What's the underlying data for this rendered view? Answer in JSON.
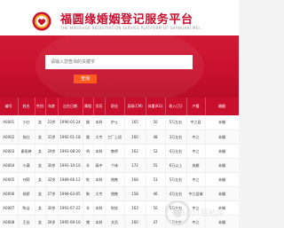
{
  "header": {
    "title": "福圆缘婚姻登记服务平台",
    "subtitle": "THE MARRIAGE REGISTRATION SERVICE PLATFORM OF SHANGHAI MEI..."
  },
  "search": {
    "placeholder": "请输入您查询的关键字",
    "button_label": "查询"
  },
  "table": {
    "columns": [
      "编号",
      "姓名",
      "性别",
      "年龄",
      "出生日期",
      "属相",
      "学历",
      "职业",
      "身高(CM)",
      "体重(KG)",
      "收入(万)",
      "户籍",
      "婚姻"
    ],
    "rows": [
      [
        "A0001",
        "小红",
        "女",
        "23岁",
        "1990-05-24",
        "猴",
        "本科",
        "护士",
        "165",
        "50",
        "5万左右",
        "中江县",
        "未婚"
      ],
      [
        "A0002",
        "张红",
        "女",
        "31岁",
        "1992-01-18",
        "猴",
        "大专",
        "工厂上班",
        "160",
        "48",
        "3万左右",
        "中江",
        "未婚"
      ],
      [
        "A0003",
        "谢雨婷",
        "女",
        "29岁",
        "1993-08-20",
        "鸡",
        "本科",
        "教师",
        "162",
        "52",
        "4万左右",
        "中江",
        "未婚"
      ],
      [
        "A0004",
        "小满",
        "女",
        "30岁",
        "1991-10-10",
        "羊",
        "高中",
        "个体",
        "172",
        "55",
        "6万以上",
        "成都",
        "未婚"
      ],
      [
        "A0005",
        "刘莉",
        "女",
        "32岁",
        "1989-06-12",
        "蛇",
        "本科",
        "销售",
        "168",
        "53",
        "5万左右",
        "中江",
        "未婚"
      ],
      [
        "A0006",
        "胡娇",
        "女",
        "27岁",
        "1994-03-05",
        "狗",
        "大专",
        "销售",
        "158",
        "46",
        "4万左右",
        "中江县城",
        "未婚"
      ],
      [
        "A0007",
        "陈洁",
        "女",
        "30岁",
        "1991-07-22",
        "羊",
        "本科",
        "财务",
        "163",
        "50",
        "5万左右",
        "中江",
        "未婚"
      ],
      [
        "A0008",
        "王佳",
        "女",
        "26岁",
        "1995-09-16",
        "猪",
        "本科",
        "文员",
        "160",
        "47",
        "4万左右",
        "中江",
        "未婚"
      ]
    ]
  },
  "footer_brand": {
    "text": "0401导航库",
    "icon": "logo-icon"
  },
  "colors": {
    "primary": "#c8102e",
    "button": "#ff5a1f"
  }
}
